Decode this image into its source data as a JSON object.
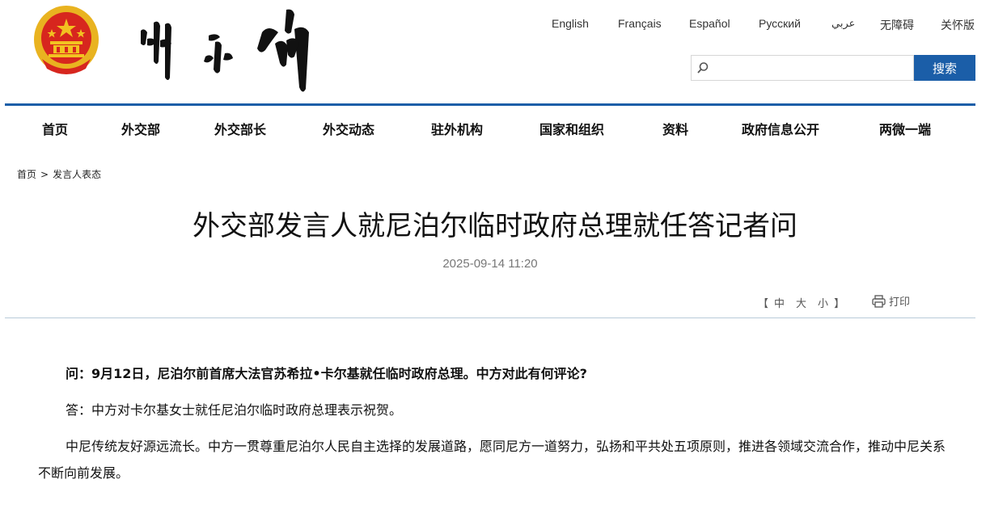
{
  "header": {
    "emblem_icon": "national-emblem-icon",
    "logo_calligraphy": "外交部",
    "languages": [
      "English",
      "Français",
      "Español",
      "Русский",
      "عربي",
      "无障碍",
      "关怀版"
    ],
    "search": {
      "placeholder": "",
      "button_label": "搜索",
      "icon": "search-icon"
    }
  },
  "nav": {
    "items": [
      "首页",
      "外交部",
      "外交部长",
      "外交动态",
      "驻外机构",
      "国家和组织",
      "资料",
      "政府信息公开",
      "两微一端"
    ]
  },
  "breadcrumb": {
    "home": "首页",
    "separator": ">",
    "current": "发言人表态"
  },
  "article": {
    "title": "外交部发言人就尼泊尔临时政府总理就任答记者问",
    "date": "2025-09-14 11:20",
    "font_size_label_open": "【",
    "font_sizes": [
      "中",
      "大",
      "小"
    ],
    "font_size_label_close": "】",
    "print_label": "打印",
    "paragraphs": [
      "问：9月12日，尼泊尔前首席大法官苏希拉•卡尔基就任临时政府总理。中方对此有何评论?",
      "答：中方对卡尔基女士就任尼泊尔临时政府总理表示祝贺。",
      "中尼传统友好源远流长。中方一贯尊重尼泊尔人民自主选择的发展道路，愿同尼方一道努力，弘扬和平共处五项原则，推进各领域交流合作，推动中尼关系不断向前发展。"
    ]
  },
  "colors": {
    "accent": "#1b5ea8",
    "emblem_red": "#d7261e",
    "emblem_gold": "#f2c221"
  }
}
